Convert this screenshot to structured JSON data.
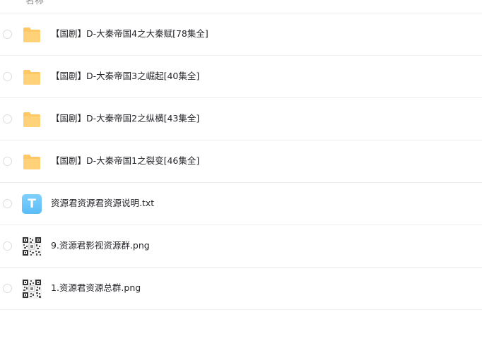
{
  "header": {
    "name_label": "名称"
  },
  "files": [
    {
      "name": "【国剧】D-大秦帝国4之大秦赋[78集全]",
      "icon": "folder-icon",
      "type": "folder"
    },
    {
      "name": "【国剧】D-大秦帝国3之崛起[40集全]",
      "icon": "folder-icon",
      "type": "folder"
    },
    {
      "name": "【国剧】D-大秦帝国2之纵横[43集全]",
      "icon": "folder-icon",
      "type": "folder"
    },
    {
      "name": "【国剧】D-大秦帝国1之裂变[46集全]",
      "icon": "folder-icon",
      "type": "folder"
    },
    {
      "name": "资源君资源君资源说明.txt",
      "icon": "txt-file-icon",
      "type": "txt",
      "icon_letter": "T"
    },
    {
      "name": "9.资源君影视资源群.png",
      "icon": "qr-image-icon",
      "type": "image"
    },
    {
      "name": "1.资源君资源总群.png",
      "icon": "qr-image-icon",
      "type": "image"
    }
  ],
  "colors": {
    "folder": "#ffc865",
    "txt_icon": "#6cc6fb",
    "divider": "#eeeeee"
  }
}
